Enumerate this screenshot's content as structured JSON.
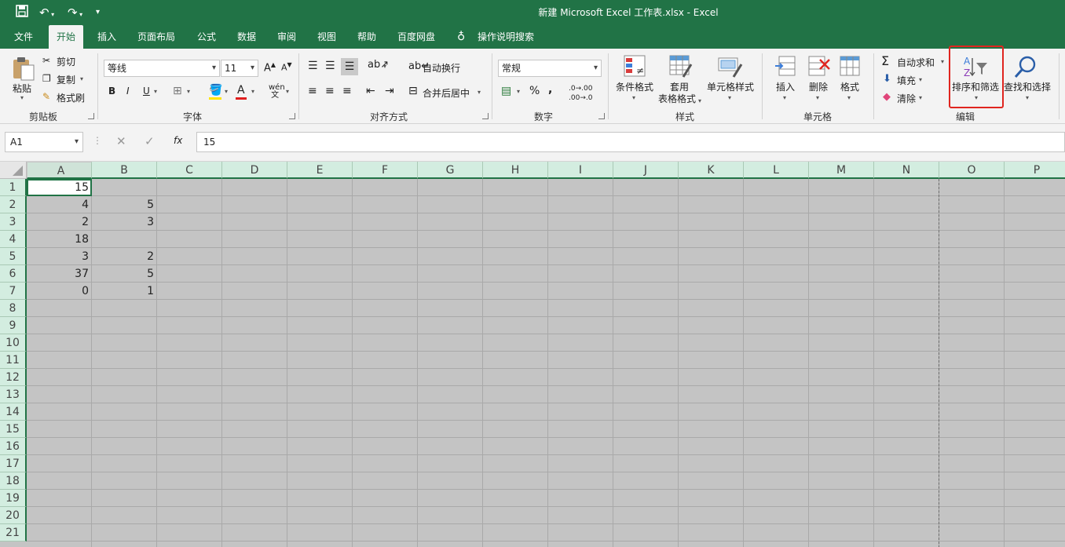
{
  "window": {
    "title": "新建 Microsoft Excel 工作表.xlsx  -  Excel"
  },
  "tabs": [
    {
      "label": "文件"
    },
    {
      "label": "开始"
    },
    {
      "label": "插入"
    },
    {
      "label": "页面布局"
    },
    {
      "label": "公式"
    },
    {
      "label": "数据"
    },
    {
      "label": "审阅"
    },
    {
      "label": "视图"
    },
    {
      "label": "帮助"
    },
    {
      "label": "百度网盘"
    },
    {
      "label": "操作说明搜索"
    }
  ],
  "ribbon": {
    "clipboard": {
      "paste": "粘贴",
      "cut": "剪切",
      "copy": "复制",
      "format_painter": "格式刷",
      "group": "剪贴板"
    },
    "font": {
      "name": "等线",
      "size": "11",
      "bold": "B",
      "italic": "I",
      "underline": "U",
      "group": "字体"
    },
    "alignment": {
      "wrap": "自动换行",
      "merge": "合并后居中",
      "group": "对齐方式"
    },
    "number": {
      "format": "常规",
      "percent": "%",
      "comma": ",",
      "inc_decimal": ".0→.00",
      "dec_decimal": ".00→.0",
      "group": "数字"
    },
    "styles": {
      "conditional": "条件格式",
      "table_1": "套用",
      "table_2": "表格格式",
      "cell_styles": "单元格样式",
      "group": "样式"
    },
    "cells": {
      "insert": "插入",
      "delete": "删除",
      "format": "格式",
      "group": "单元格"
    },
    "editing": {
      "autosum": "自动求和",
      "fill": "填充",
      "clear": "清除",
      "sort_filter": "排序和筛选",
      "find_select": "查找和选择",
      "group": "编辑"
    }
  },
  "formula_bar": {
    "name_box": "A1",
    "fx": "fx",
    "value": "15"
  },
  "sheet": {
    "columns": [
      "A",
      "B",
      "C",
      "D",
      "E",
      "F",
      "G",
      "H",
      "I",
      "J",
      "K",
      "L",
      "M",
      "N",
      "O",
      "P"
    ],
    "rows": [
      "1",
      "2",
      "3",
      "4",
      "5",
      "6",
      "7",
      "8",
      "9",
      "10",
      "11",
      "12",
      "13",
      "14",
      "15",
      "16",
      "17",
      "18",
      "19",
      "20",
      "21"
    ],
    "cells": [
      {
        "col": "A",
        "row": 1,
        "value": "15"
      },
      {
        "col": "A",
        "row": 2,
        "value": "4"
      },
      {
        "col": "B",
        "row": 2,
        "value": "5"
      },
      {
        "col": "A",
        "row": 3,
        "value": "2"
      },
      {
        "col": "B",
        "row": 3,
        "value": "3"
      },
      {
        "col": "A",
        "row": 4,
        "value": "18"
      },
      {
        "col": "A",
        "row": 5,
        "value": "3"
      },
      {
        "col": "B",
        "row": 5,
        "value": "2"
      },
      {
        "col": "A",
        "row": 6,
        "value": "37"
      },
      {
        "col": "B",
        "row": 6,
        "value": "5"
      },
      {
        "col": "A",
        "row": 7,
        "value": "0"
      },
      {
        "col": "B",
        "row": 7,
        "value": "1"
      }
    ]
  },
  "colors": {
    "accent": "#217346",
    "highlight": "#e0251f",
    "grid_bg": "#c4c4c4"
  }
}
